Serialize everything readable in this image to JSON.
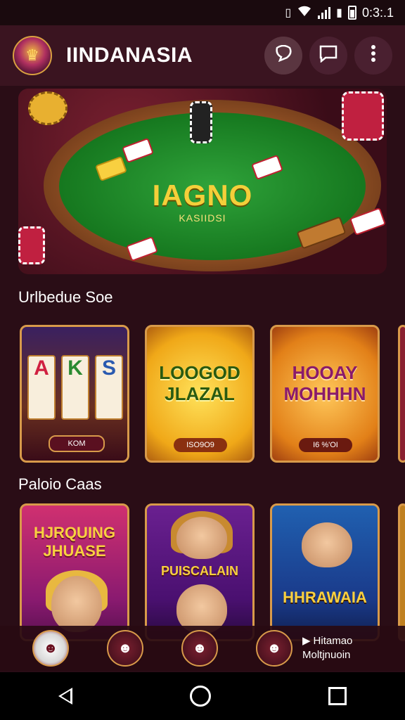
{
  "status_bar": {
    "time": "0:3:.1",
    "icons": [
      "vibrate-icon",
      "wifi-icon",
      "signal-icon",
      "battery-icon"
    ]
  },
  "header": {
    "title": "IINDANASIA",
    "buttons": [
      {
        "icon": "chat-bubble-icon"
      },
      {
        "icon": "message-icon"
      },
      {
        "icon": "more-vertical-icon"
      }
    ]
  },
  "hero": {
    "title": "IAGNO",
    "subtitle": "KASIIDSI"
  },
  "sections": [
    {
      "title": "Urlbedue Soe",
      "cards": [
        {
          "title": "",
          "button_label": "KOM",
          "reels": [
            "A",
            "K",
            "S"
          ]
        },
        {
          "title": "LOOGOD JLAZAL",
          "button_label": "ISO9O9"
        },
        {
          "title": "HOOAY MOHHHN",
          "button_label": "I6 %'OI"
        }
      ]
    },
    {
      "title": "Paloio Caas",
      "cards": [
        {
          "title": "HJRQUING JHUASE"
        },
        {
          "title": "PUISCALAIN"
        },
        {
          "title": "HHRAWAIA"
        }
      ]
    }
  ],
  "bottom_strip": {
    "line1": "Hitamao",
    "line2": "Moltjnuoin"
  },
  "colors": {
    "background": "#2a0d16",
    "header": "#3a1420",
    "accent_gold": "#d89a4a",
    "felt_green": "#16781f"
  }
}
